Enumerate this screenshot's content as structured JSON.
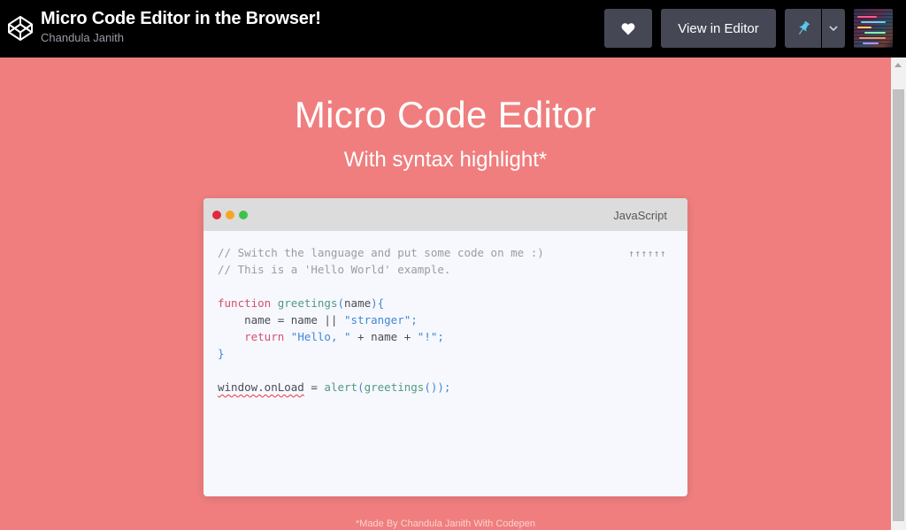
{
  "header": {
    "title": "Micro Code Editor in the Browser!",
    "author": "Chandula Janith",
    "view_in_editor_label": "View in Editor"
  },
  "page": {
    "heading": "Micro Code Editor",
    "subheading": "With syntax highlight*",
    "footer": "*Made By Chandula Janith With Codepen"
  },
  "editor": {
    "language": "JavaScript",
    "arrows": "↑↑↑↑↑↑",
    "lines": [
      "// Switch the language and put some code on me :)",
      "// This is a 'Hello World' example.",
      "",
      "function greetings(name){",
      "    name = name || \"stranger\";",
      "    return \"Hello, \" + name + \"!\";",
      "}",
      "",
      "window.onLoad = alert(greetings());"
    ]
  },
  "icons": {
    "logo": "codepen-logo-icon",
    "like": "heart-icon",
    "pin": "pin-icon",
    "dropdown": "chevron-down-icon"
  },
  "colors": {
    "page_background": "#f07e7e",
    "topbar": "#000000",
    "button": "#454854",
    "pin_accent": "#5cc8f0",
    "keyword": "#d74e6d",
    "function": "#4f9a83",
    "string": "#3d87d9",
    "comment": "#9a9ca4"
  }
}
